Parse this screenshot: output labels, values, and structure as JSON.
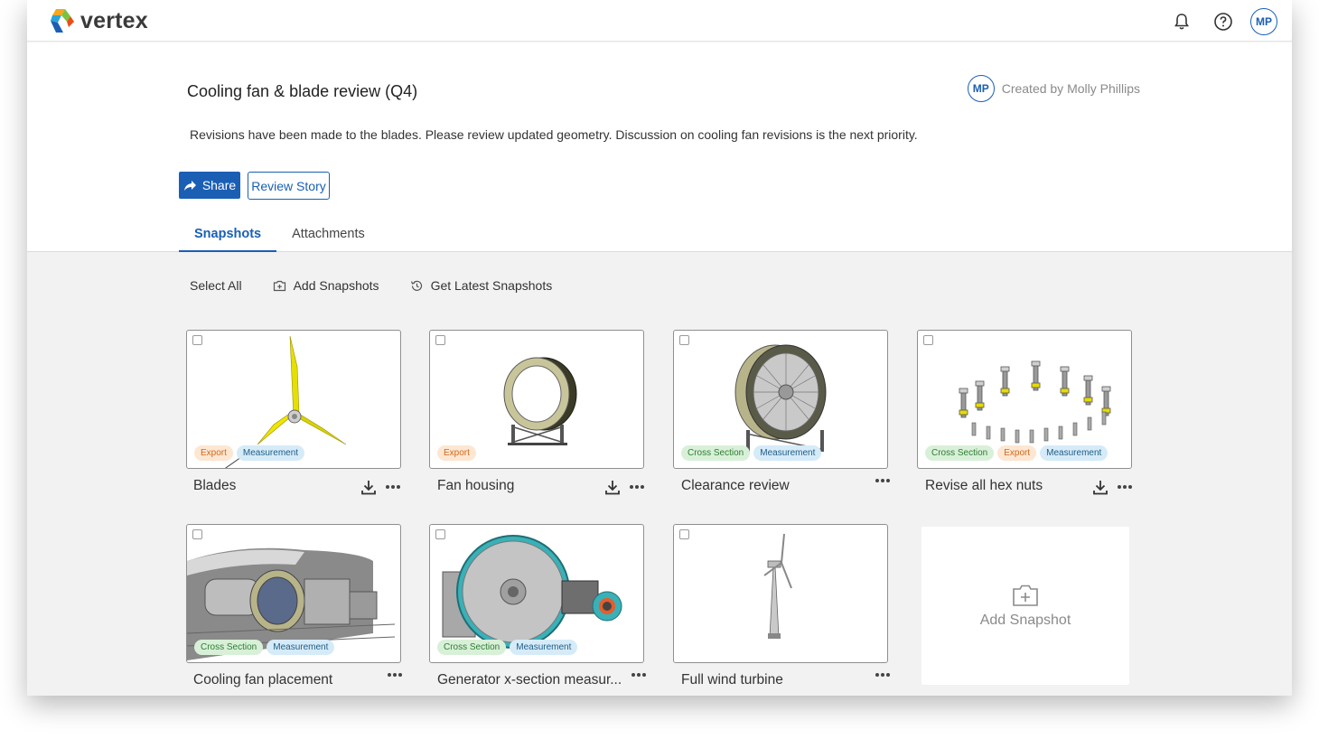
{
  "app": {
    "name": "vertex"
  },
  "topbar": {
    "avatar_initials": "MP",
    "icons": [
      "bell-icon",
      "help-icon"
    ]
  },
  "story": {
    "title": "Cooling fan & blade review (Q4)",
    "creator_initials": "MP",
    "created_by": "Created by Molly Phillips",
    "description": "Revisions have been made to the blades. Please review updated geometry. Discussion on cooling fan revisions is the next priority."
  },
  "actions": {
    "share_label": "Share",
    "review_label": "Review Story"
  },
  "tabs": [
    {
      "label": "Snapshots",
      "active": true
    },
    {
      "label": "Attachments",
      "active": false
    }
  ],
  "toolbar": {
    "select_all": "Select All",
    "add_snapshots": "Add Snapshots",
    "get_latest": "Get Latest Snapshots"
  },
  "snapshots": [
    {
      "label": "Blades",
      "tags": [
        "Export",
        "Measurement"
      ],
      "download": true
    },
    {
      "label": "Fan housing",
      "tags": [
        "Export"
      ],
      "download": true
    },
    {
      "label": "Clearance review",
      "tags": [
        "Cross Section",
        "Measurement"
      ],
      "download": false
    },
    {
      "label": "Revise all hex nuts",
      "tags": [
        "Cross Section",
        "Export",
        "Measurement"
      ],
      "download": true
    },
    {
      "label": "Cooling fan placement",
      "tags": [
        "Cross Section",
        "Measurement"
      ],
      "download": false
    },
    {
      "label": "Generator x-section measur...",
      "tags": [
        "Cross Section",
        "Measurement"
      ],
      "download": false
    },
    {
      "label": "Full wind turbine",
      "tags": [],
      "download": false
    }
  ],
  "add_snapshot_label": "Add Snapshot",
  "colors": {
    "accent": "#1a5fb4",
    "export_tag": "#d2691e",
    "measure_tag": "#1f5d87",
    "cross_tag": "#2e7d32"
  }
}
